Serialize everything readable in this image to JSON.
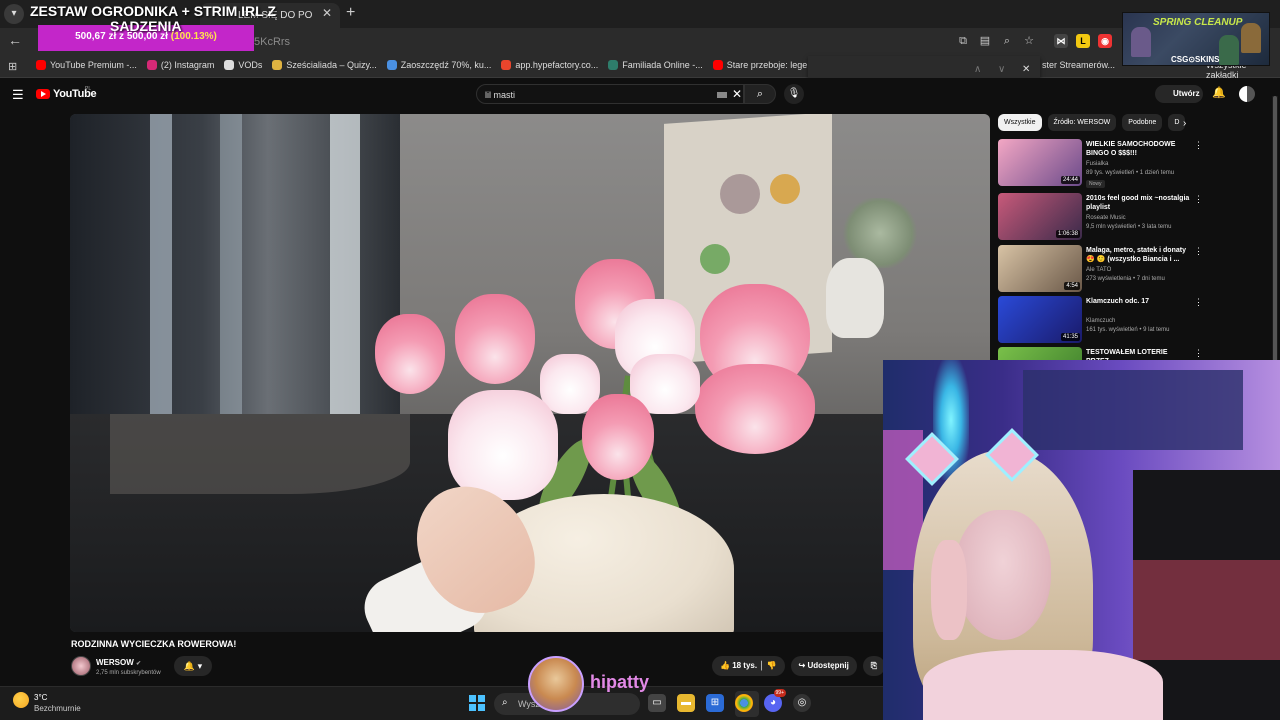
{
  "browser": {
    "tab_title": "LEM SIĘ DO PO",
    "url_fragment": "5KcRrs",
    "bookmarks": [
      {
        "label": "YouTube Premium -...",
        "color": "#ff0000"
      },
      {
        "label": "(2) Instagram",
        "color": "#d62976"
      },
      {
        "label": "VODs",
        "color": "#dddddd"
      },
      {
        "label": "Sześcialiada – Quizy...",
        "color": "#e0b341"
      },
      {
        "label": "Zaoszczędź 70%, ku...",
        "color": "#4a90e2"
      },
      {
        "label": "app.hypefactory.co...",
        "color": "#e8452c"
      },
      {
        "label": "Familiada Online -...",
        "color": "#2e7d6b"
      },
      {
        "label": "Stare przeboje: lege...",
        "color": "#ff0000"
      }
    ],
    "bookmark_right": "ster Streamerów...",
    "bookmark_more": "»",
    "bookmark_all": "Wszystkie zakładki"
  },
  "overlay": {
    "goal_title": "ZESTAW OGRODNIKA + STRIM IRL Z",
    "goal_title2": "SADZENIA",
    "goal_current": "500,67 zł",
    "goal_sep": "z",
    "goal_target": "500,00 zł",
    "goal_pct": "(100.13%)",
    "ad_title": "SPRING CLEANUP",
    "ad_brand": "CSG⊙SKINS",
    "streamer_name": "hipatty"
  },
  "youtube": {
    "logo": "YouTube",
    "region": "PL",
    "search_value": "lil masti",
    "create_label": "Utwórz",
    "video_title": "RODZINNA WYCIECZKA ROWEROWA!",
    "channel_name": "WERSOW",
    "channel_subs": "2,75 mln subskrybentów",
    "likes": "18 tys.",
    "share_label": "Udostępnij",
    "chips": [
      "Wszystkie",
      "Źródło: WERSOW",
      "Podobne",
      "D"
    ],
    "recommendations": [
      {
        "title": "WIELKIE SAMOCHODOWE BINGO O $$$!!!",
        "channel": "Fusialka",
        "meta": "89 tys. wyświetleń • 1 dzień temu",
        "duration": "24:44",
        "badge": "Nowy",
        "colors": [
          "#f3a7c4",
          "#6b4a8a"
        ]
      },
      {
        "title": "2010s feel good mix ~nostalgia playlist",
        "channel": "Roseate Music",
        "meta": "9,5 mln wyświetleń • 3 lata temu",
        "duration": "1:06:38",
        "badge": "",
        "colors": [
          "#c85a7a",
          "#3a2a4a"
        ]
      },
      {
        "title": "Malaga, metro, statek i donaty 😍 🙂 (wszystko Biancia i ...",
        "channel": "Ale TATO",
        "meta": "273 wyświetlenia • 7 dni temu",
        "duration": "4:54",
        "badge": "",
        "colors": [
          "#d8c3a5",
          "#6a5848"
        ]
      },
      {
        "title": "Klamczuch odc. 17",
        "channel": "Klamczuch",
        "meta": "161 tys. wyświetleń • 9 lat temu",
        "duration": "41:35",
        "badge": "",
        "colors": [
          "#2a4ad8",
          "#1a1a6a"
        ]
      },
      {
        "title": "TESTOWAŁEM LOTERIE PRZEZ",
        "channel": "",
        "meta": "",
        "duration": "",
        "badge": "",
        "colors": [
          "#7ac04a",
          "#3a7a2a"
        ]
      }
    ]
  },
  "taskbar": {
    "temperature": "3°C",
    "condition": "Bezchmurnie",
    "search_text": "Wysz",
    "discord_badge": "99+"
  }
}
